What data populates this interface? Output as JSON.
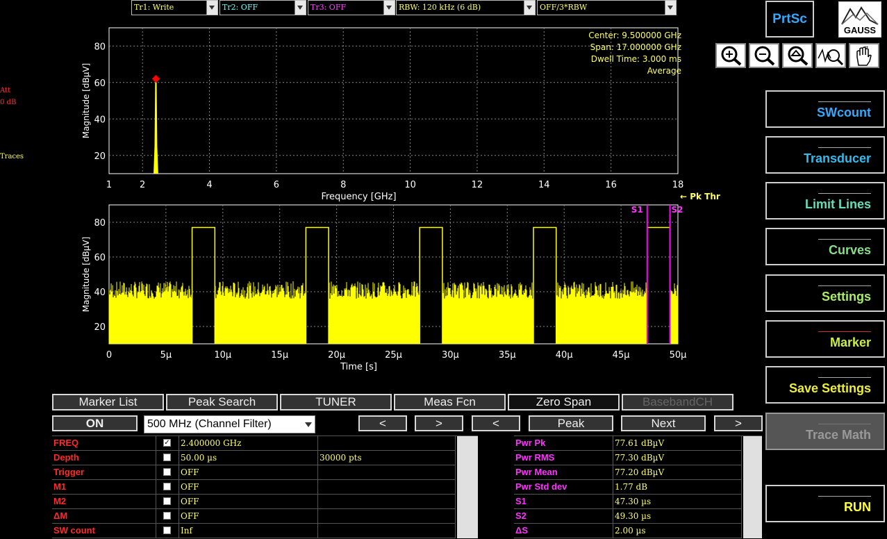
{
  "top_dropdowns": [
    {
      "label": "Tr1: Write",
      "color": "#ffff66"
    },
    {
      "label": "Tr2: OFF",
      "color": "#66ffff"
    },
    {
      "label": "Tr3: OFF",
      "color": "#ff44ff"
    },
    {
      "label": "RBW: 120 kHz (6 dB)",
      "color": "#ffff66"
    },
    {
      "label": "OFF/3*RBW",
      "color": "#ffff66"
    }
  ],
  "left_info": {
    "att": "Att",
    "att_value": "0 dB",
    "traces": "Traces"
  },
  "spectrum": {
    "ylabel": "Magnitude [dBµV]",
    "xlabel": "Frequency [GHz]",
    "info": [
      "Center: 9.500000 GHz",
      "Span: 17.000000 GHz",
      "Dwell Time: 3.000 ms",
      "Average"
    ],
    "xticks": [
      "1",
      "2",
      "4",
      "6",
      "8",
      "10",
      "12",
      "14",
      "16",
      "18"
    ],
    "yticks": [
      "20",
      "40",
      "60",
      "80"
    ],
    "pk_thr": "← Pk Thr"
  },
  "zerospan": {
    "ylabel": "Magnitude [dBµV]",
    "xlabel": "Time [s]",
    "xticks": [
      "0",
      "5µ",
      "10µ",
      "15µ",
      "20µ",
      "25µ",
      "30µ",
      "35µ",
      "40µ",
      "45µ",
      "50µ"
    ],
    "yticks": [
      "20",
      "40",
      "60",
      "80"
    ],
    "s1": "S1",
    "s2": "S2"
  },
  "chart_data": [
    {
      "type": "line",
      "title": "",
      "xlabel": "Frequency [GHz]",
      "ylabel": "Magnitude [dBµV]",
      "xlim": [
        1,
        18
      ],
      "ylim": [
        10,
        90
      ],
      "series": [
        {
          "name": "Tr1",
          "x": [
            2.35,
            2.38,
            2.4,
            2.42,
            2.45
          ],
          "y": [
            10,
            25,
            62,
            25,
            10
          ]
        }
      ],
      "marker": {
        "x": 2.4,
        "y": 62
      }
    },
    {
      "type": "line",
      "title": "",
      "xlabel": "Time [s]",
      "ylabel": "Magnitude [dBµV]",
      "xlim": [
        0,
        50
      ],
      "ylim": [
        10,
        90
      ],
      "bursts": [
        [
          7.3,
          8.3
        ],
        [
          17.3,
          18.3
        ],
        [
          27.3,
          28.3
        ],
        [
          37.3,
          38.3
        ],
        [
          47.3,
          48.3
        ]
      ],
      "burst_level": 77,
      "noise_level": 40,
      "s1": 47.3,
      "s2": 49.3
    }
  ],
  "tabs": [
    "Marker List",
    "Peak Search",
    "TUNER",
    "Meas Fcn",
    "Zero Span",
    "BasebandCH"
  ],
  "controls": {
    "on": "ON",
    "filter": "500 MHz (Channel Filter)",
    "prev1": "<",
    "next1": ">",
    "prev2": "<",
    "peak": "Peak",
    "next": "Next",
    "next2": ">"
  },
  "left_table": [
    {
      "label": "FREQ",
      "checked": true,
      "value": "2.400000 GHz",
      "extra": ""
    },
    {
      "label": "Depth",
      "checked": false,
      "value": "50.00 µs",
      "extra": "30000 pts"
    },
    {
      "label": "Trigger",
      "checked": false,
      "value": "OFF",
      "extra": ""
    },
    {
      "label": "M1",
      "checked": false,
      "value": "OFF",
      "extra": ""
    },
    {
      "label": "M2",
      "checked": false,
      "value": "OFF",
      "extra": ""
    },
    {
      "label": "ΔM",
      "checked": false,
      "value": "OFF",
      "extra": ""
    },
    {
      "label": "SW count",
      "checked": false,
      "value": "Inf",
      "extra": ""
    }
  ],
  "right_table": [
    {
      "label": "Pwr Pk",
      "value": "77.61 dBµV"
    },
    {
      "label": "Pwr RMS",
      "value": "77.30 dBµV"
    },
    {
      "label": "Pwr Mean",
      "value": "77.20 dBµV"
    },
    {
      "label": "Pwr Std dev",
      "value": "1.77 dB"
    },
    {
      "label": "S1",
      "value": "47.30 µs"
    },
    {
      "label": "S2",
      "value": "49.30 µs"
    },
    {
      "label": "ΔS",
      "value": "2.00 µs"
    }
  ],
  "side_buttons": [
    {
      "label": "SWcount",
      "color": "#33aaff"
    },
    {
      "label": "Transducer",
      "color": "#33bbee"
    },
    {
      "label": "Limit Lines",
      "color": "#66ddbb"
    },
    {
      "label": "Curves",
      "color": "#88dd88"
    },
    {
      "label": "Settings",
      "color": "#aaee66"
    },
    {
      "label": "Marker",
      "color": "#ccee44"
    },
    {
      "label": "Save Settings",
      "color": "#eeee33"
    },
    {
      "label": "Trace Math",
      "color": "#888888"
    },
    {
      "label": "RUN",
      "color": "#ffff33"
    }
  ],
  "prtsc": "PrtSc",
  "gauss": "GAUSS",
  "zoom_icons": [
    "zoom-in-icon",
    "zoom-out-icon",
    "zoom-fit-icon",
    "zoom-trace-icon",
    "hand-icon"
  ]
}
